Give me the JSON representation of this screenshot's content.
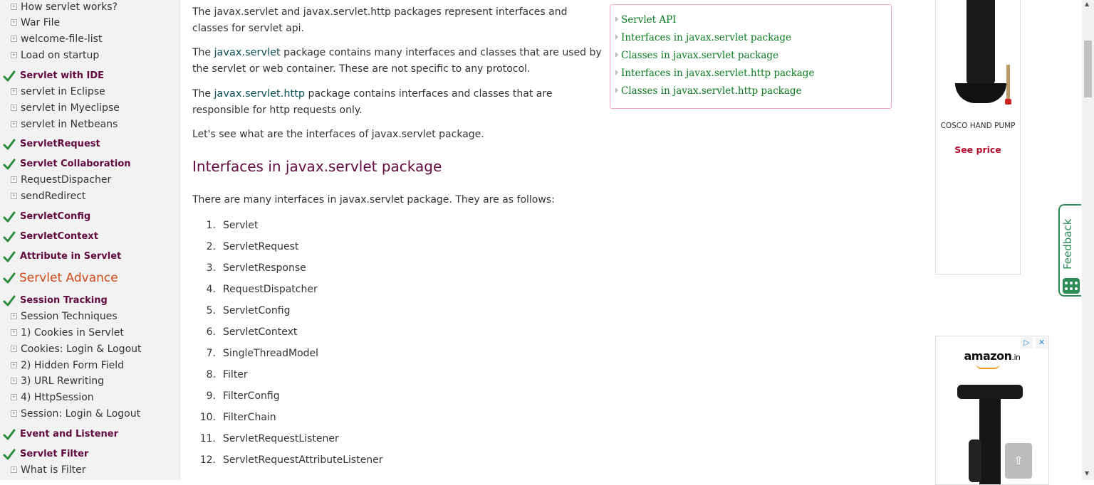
{
  "sidebar": {
    "items": [
      {
        "type": "sub",
        "label": "How servlet works?"
      },
      {
        "type": "sub",
        "label": "War File"
      },
      {
        "type": "sub",
        "label": "welcome-file-list"
      },
      {
        "type": "sub",
        "label": "Load on startup"
      },
      {
        "type": "head",
        "label": "Servlet with IDE"
      },
      {
        "type": "sub",
        "label": "servlet in Eclipse"
      },
      {
        "type": "sub",
        "label": "servlet in Myeclipse"
      },
      {
        "type": "sub",
        "label": "servlet in Netbeans"
      },
      {
        "type": "head",
        "label": "ServletRequest"
      },
      {
        "type": "head",
        "label": "Servlet Collaboration"
      },
      {
        "type": "sub",
        "label": "RequestDispacher"
      },
      {
        "type": "sub",
        "label": "sendRedirect"
      },
      {
        "type": "head",
        "label": "ServletConfig"
      },
      {
        "type": "head",
        "label": "ServletContext"
      },
      {
        "type": "head",
        "label": "Attribute in Servlet"
      },
      {
        "type": "big",
        "label": "Servlet Advance"
      },
      {
        "type": "head",
        "label": "Session Tracking"
      },
      {
        "type": "sub",
        "label": "Session Techniques"
      },
      {
        "type": "sub",
        "label": "1) Cookies in Servlet"
      },
      {
        "type": "sub",
        "label": "Cookies: Login & Logout"
      },
      {
        "type": "sub",
        "label": "2) Hidden Form Field"
      },
      {
        "type": "sub",
        "label": "3) URL Rewriting"
      },
      {
        "type": "sub",
        "label": "4) HttpSession"
      },
      {
        "type": "sub",
        "label": "Session: Login & Logout"
      },
      {
        "type": "head",
        "label": "Event and Listener"
      },
      {
        "type": "head",
        "label": "Servlet Filter"
      },
      {
        "type": "sub",
        "label": "What is Filter"
      }
    ],
    "expander_glyph": "+",
    "colors": {
      "heading": "#610a3f",
      "advance": "#d14a18",
      "check": "#2b8a3e",
      "background": "#f2f2f2"
    }
  },
  "content": {
    "p1": "The javax.servlet and javax.servlet.http packages represent interfaces and classes for servlet api.",
    "p2_pre": "The ",
    "p2_pkg": "javax.servlet",
    "p2_post": " package contains many interfaces and classes that are used by the servlet or web container. These are not specific to any protocol.",
    "p3_pre": "The ",
    "p3_pkg": "javax.servlet.http",
    "p3_post": " package contains interfaces and classes that are responsible for http requests only.",
    "p4": "Let's see what are the interfaces of javax.servlet package.",
    "heading": "Interfaces in javax.servlet package",
    "p5": "There are many interfaces in javax.servlet package. They are as follows:",
    "list": [
      {
        "num": "1.",
        "text": "Servlet"
      },
      {
        "num": "2.",
        "text": "ServletRequest"
      },
      {
        "num": "3.",
        "text": "ServletResponse"
      },
      {
        "num": "4.",
        "text": "RequestDispatcher"
      },
      {
        "num": "5.",
        "text": "ServletConfig"
      },
      {
        "num": "6.",
        "text": "ServletContext"
      },
      {
        "num": "7.",
        "text": "SingleThreadModel"
      },
      {
        "num": "8.",
        "text": "Filter"
      },
      {
        "num": "9.",
        "text": "FilterConfig"
      },
      {
        "num": "10.",
        "text": "FilterChain"
      },
      {
        "num": "11.",
        "text": "ServletRequestListener"
      },
      {
        "num": "12.",
        "text": "ServletRequestAttributeListener"
      }
    ]
  },
  "toc": {
    "items": [
      "Servlet API",
      "Interfaces in javax.servlet package",
      "Classes in javax.servlet package",
      "Interfaces in javax.servlet.http package",
      "Classes in javax.servlet.http package"
    ],
    "link_color": "#0b7a1f",
    "border_color": "#f2a3bf"
  },
  "ads": {
    "ad1": {
      "product_name": "COSCO HAND PUMP",
      "cta": "See price"
    },
    "ad2": {
      "logo_text": "amazon",
      "logo_suffix": ".in",
      "adchoices_icon": "adchoices-icon",
      "close_icon": "close-icon",
      "badge_play": "▷",
      "badge_close": "✕"
    }
  },
  "feedback": {
    "label": "Feedback",
    "color": "#2e8b57"
  },
  "back_to_top": {
    "glyph": "⇧"
  },
  "scrollbar": {
    "up_glyph": "▲",
    "down_glyph": "▼"
  }
}
